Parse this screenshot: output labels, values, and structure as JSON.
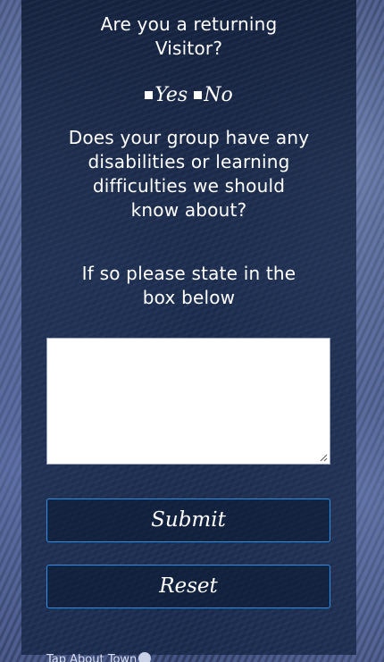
{
  "form": {
    "returning_question": "Are you a returning\nVisitor?",
    "options": [
      {
        "label": "Yes"
      },
      {
        "label": "No"
      }
    ],
    "disabilities_question": "Does your group have any\ndisabilities or learning\ndifficulties we should\nknow about?",
    "state_instruction": "If so please state in the\nbox below",
    "textarea_value": "",
    "submit_label": "Submit",
    "reset_label": "Reset"
  },
  "footer": {
    "link_text": "Tap About Town",
    "icon": "chevron-down-icon"
  },
  "colors": {
    "panel": "#16264a",
    "button_border": "#2d8fe6",
    "text": "#ffffff"
  }
}
